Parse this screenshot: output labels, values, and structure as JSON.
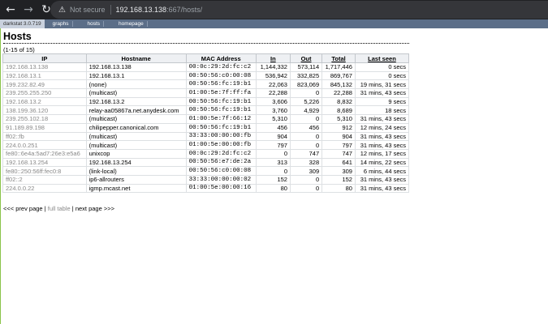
{
  "browser": {
    "back_icon": "arrow-left-icon",
    "forward_icon": "arrow-right-icon",
    "reload_icon": "reload-icon",
    "security_icon": "warning-icon",
    "security_label": "Not secure",
    "url_host": "192.168.13.138",
    "url_rest": ":667/hosts/"
  },
  "nav": {
    "brand": "darkstat 3.0.719",
    "links": [
      "graphs",
      "hosts",
      "homepage"
    ]
  },
  "page": {
    "title": "Hosts",
    "count": "(1-15 of 15)"
  },
  "table": {
    "headers": {
      "ip": "IP",
      "hostname": "Hostname",
      "mac": "MAC Address",
      "in": "In",
      "out": "Out",
      "total": "Total",
      "last_seen": "Last seen"
    },
    "rows": [
      {
        "ip": "192.168.13.138",
        "hostname": "192.168.13.138",
        "mac": "00:0c:29:2d:fc:c2",
        "in": "1,144,332",
        "out": "573,114",
        "total": "1,717,446",
        "last_seen": "0 secs"
      },
      {
        "ip": "192.168.13.1",
        "hostname": "192.168.13.1",
        "mac": "00:50:56:c0:00:08",
        "in": "536,942",
        "out": "332,825",
        "total": "869,767",
        "last_seen": "0 secs"
      },
      {
        "ip": "199.232.82.49",
        "hostname": "(none)",
        "mac": "00:50:56:fc:19:b1",
        "in": "22,063",
        "out": "823,069",
        "total": "845,132",
        "last_seen": "19 mins, 31 secs"
      },
      {
        "ip": "239.255.255.250",
        "hostname": "(multicast)",
        "mac": "01:00:5e:7f:ff:fa",
        "in": "22,288",
        "out": "0",
        "total": "22,288",
        "last_seen": "31 mins, 43 secs"
      },
      {
        "ip": "192.168.13.2",
        "hostname": "192.168.13.2",
        "mac": "00:50:56:fc:19:b1",
        "in": "3,606",
        "out": "5,226",
        "total": "8,832",
        "last_seen": "9 secs"
      },
      {
        "ip": "138.199.36.120",
        "hostname": "relay-aa05867a.net.anydesk.com",
        "mac": "00:50:56:fc:19:b1",
        "in": "3,760",
        "out": "4,929",
        "total": "8,689",
        "last_seen": "18 secs"
      },
      {
        "ip": "239.255.102.18",
        "hostname": "(multicast)",
        "mac": "01:00:5e:7f:66:12",
        "in": "5,310",
        "out": "0",
        "total": "5,310",
        "last_seen": "31 mins, 43 secs"
      },
      {
        "ip": "91.189.89.198",
        "hostname": "chilipepper.canonical.com",
        "mac": "00:50:56:fc:19:b1",
        "in": "456",
        "out": "456",
        "total": "912",
        "last_seen": "12 mins, 24 secs"
      },
      {
        "ip": "ff02::fb",
        "hostname": "(multicast)",
        "mac": "33:33:00:00:00:fb",
        "in": "904",
        "out": "0",
        "total": "904",
        "last_seen": "31 mins, 43 secs"
      },
      {
        "ip": "224.0.0.251",
        "hostname": "(multicast)",
        "mac": "01:00:5e:00:00:fb",
        "in": "797",
        "out": "0",
        "total": "797",
        "last_seen": "31 mins, 43 secs"
      },
      {
        "ip": "fe80::6e4a:5ad7:26e3:e5a6",
        "hostname": "unixcop",
        "mac": "00:0c:29:2d:fc:c2",
        "in": "0",
        "out": "747",
        "total": "747",
        "last_seen": "12 mins, 17 secs"
      },
      {
        "ip": "192.168.13.254",
        "hostname": "192.168.13.254",
        "mac": "00:50:56:e7:de:2a",
        "in": "313",
        "out": "328",
        "total": "641",
        "last_seen": "14 mins, 22 secs"
      },
      {
        "ip": "fe80::250:56ff:fec0:8",
        "hostname": "(link-local)",
        "mac": "00:50:56:c0:00:08",
        "in": "0",
        "out": "309",
        "total": "309",
        "last_seen": "6 mins, 44 secs"
      },
      {
        "ip": "ff02::2",
        "hostname": "ip6-allrouters",
        "mac": "33:33:00:00:00:02",
        "in": "152",
        "out": "0",
        "total": "152",
        "last_seen": "31 mins, 43 secs"
      },
      {
        "ip": "224.0.0.22",
        "hostname": "igmp.mcast.net",
        "mac": "01:00:5e:00:00:16",
        "in": "80",
        "out": "0",
        "total": "80",
        "last_seen": "31 mins, 43 secs"
      }
    ]
  },
  "pager": {
    "prev": "<<< prev page",
    "full": "full table",
    "next": "next page >>>",
    "separator": "|"
  }
}
